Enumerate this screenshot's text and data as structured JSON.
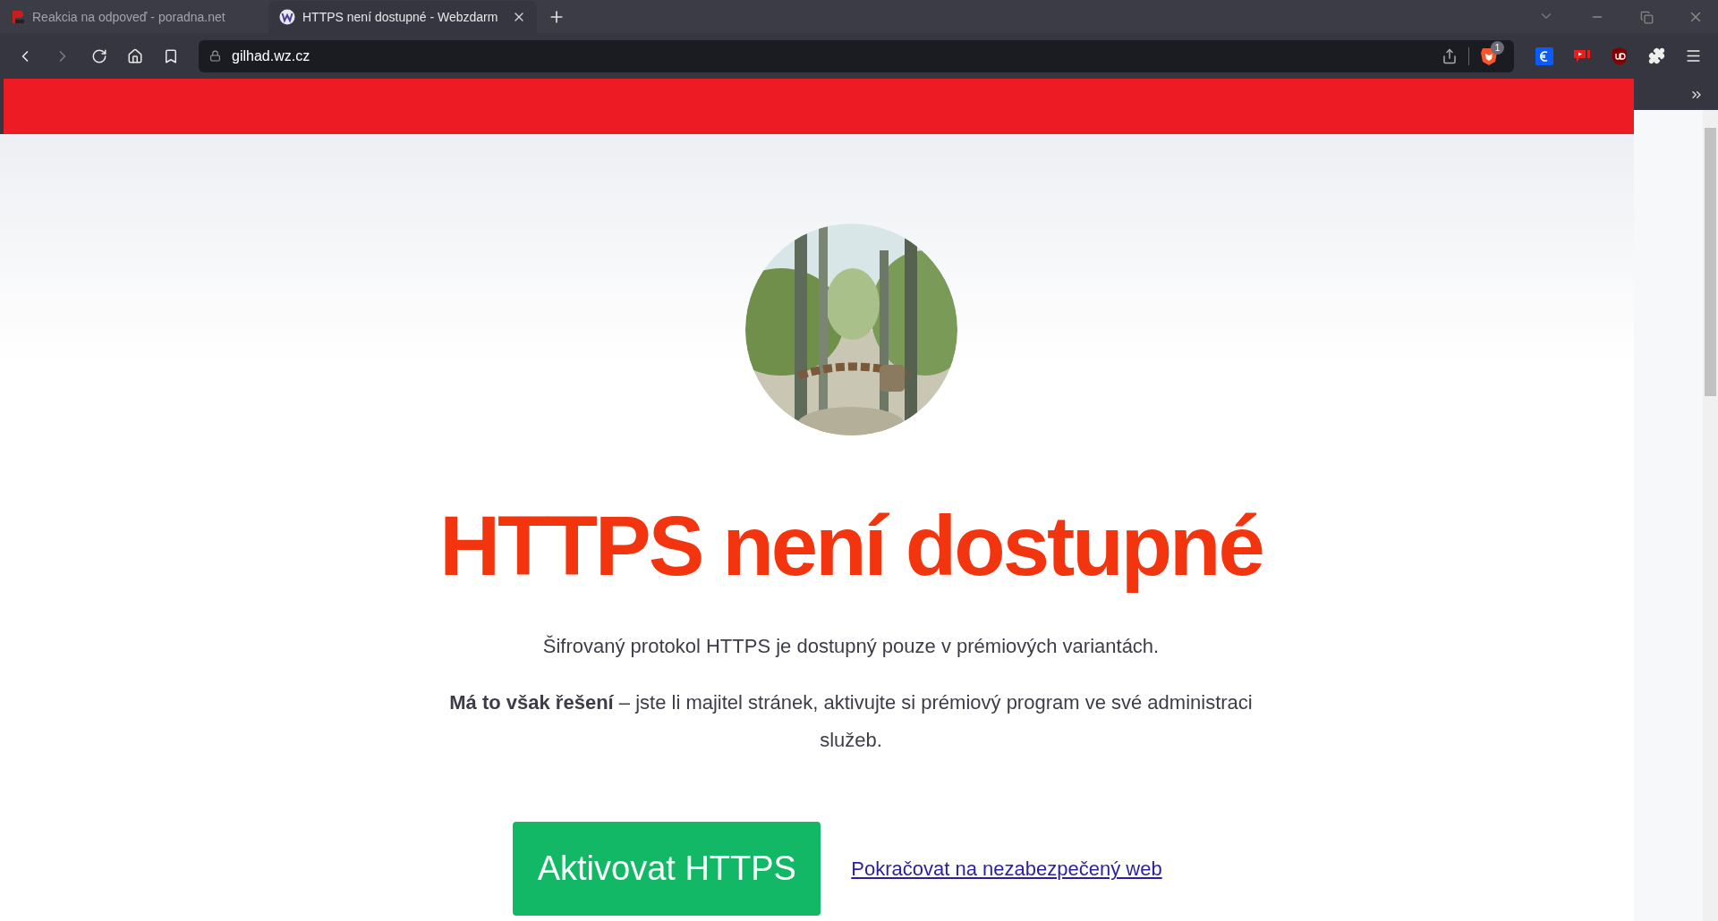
{
  "browser": {
    "tabs": [
      {
        "title": "Reakcia na odpoveď - poradna.net",
        "selected": false,
        "kind": "net"
      },
      {
        "title": "HTTPS není dostupné - Webzdarm",
        "selected": true,
        "kind": "w"
      }
    ],
    "address": "gilhad.wz.cz",
    "shield_badge": "1"
  },
  "page": {
    "heading": "HTTPS není dostupné",
    "intro": "Šifrovaný protokol HTTPS je dostupný pouze v prémiových variantách.",
    "solution": "**Má to však řešení** – jste li majitel stránek, aktivujte si prémiový program ve své administraci služeb.",
    "primary_button": "Aktivovat HTTPS",
    "link": "Pokračovat na nezabezpečený web"
  }
}
